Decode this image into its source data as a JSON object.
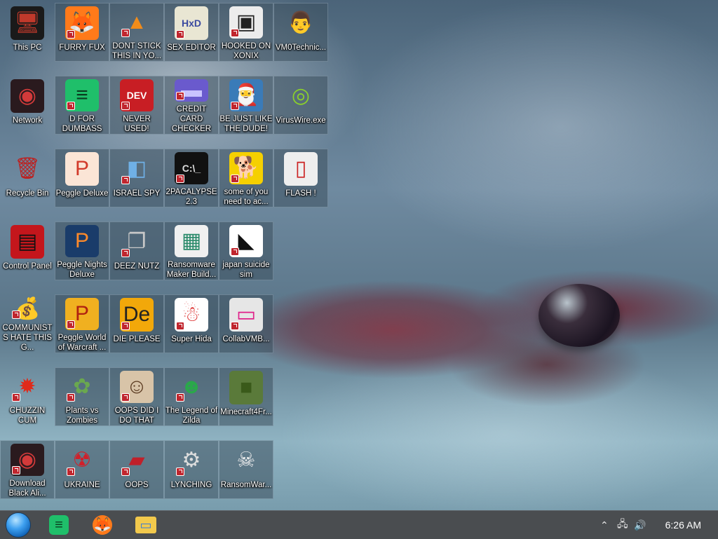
{
  "desktop": {
    "icons": [
      {
        "name": "this-pc",
        "label": "This PC",
        "glyph": "🖥",
        "bg": "#1a1a1a",
        "fg": "#c0392b",
        "shortcut": false
      },
      {
        "name": "furry-fux",
        "label": "FURRY FUX",
        "glyph": "🦊",
        "bg": "#ff7a1a",
        "fg": "#5a2bd6",
        "shortcut": true
      },
      {
        "name": "dont-stick-this",
        "label": "DONT STICK THIS IN YO...",
        "glyph": "▲",
        "bg": "transparent",
        "fg": "#f28c1a",
        "shortcut": true
      },
      {
        "name": "sex-editor",
        "label": "SEX EDITOR",
        "glyph": "HxD",
        "bg": "#e9e6d3",
        "fg": "#3b4aa0",
        "shortcut": true
      },
      {
        "name": "hooked-on-xonix",
        "label": "HOOKED ON XONIX",
        "glyph": "▣",
        "bg": "#ececec",
        "fg": "#222",
        "shortcut": true
      },
      {
        "name": "vm0technic",
        "label": "VM0Technic...",
        "glyph": "👨",
        "bg": "transparent",
        "fg": "#e8a060",
        "shortcut": false
      },
      {
        "name": "network",
        "label": "Network",
        "glyph": "◉",
        "bg": "#2a1a1e",
        "fg": "#d23a3a",
        "shortcut": false
      },
      {
        "name": "d-for-dumbass",
        "label": "D FOR DUMBASS",
        "glyph": "≡",
        "bg": "#1fbf6a",
        "fg": "#0a3d20",
        "shortcut": true
      },
      {
        "name": "never-used",
        "label": "NEVER USED!",
        "glyph": "DEV",
        "bg": "#c81e24",
        "fg": "#ffffff",
        "shortcut": true
      },
      {
        "name": "credit-card-checker",
        "label": "CREDIT CARD CHECKER",
        "glyph": "▬",
        "bg": "#6a5acd",
        "fg": "#c9c3ff",
        "shortcut": true
      },
      {
        "name": "be-just-like-the-dude",
        "label": "BE JUST LIKE THE DUDE!",
        "glyph": "🎅",
        "bg": "#3a7bb8",
        "fg": "#fff",
        "shortcut": true
      },
      {
        "name": "viruswire",
        "label": "VirusWire.exe",
        "glyph": "◎",
        "bg": "transparent",
        "fg": "#8bd12a",
        "shortcut": false
      },
      {
        "name": "recycle-bin",
        "label": "Recycle Bin",
        "glyph": "🗑",
        "bg": "transparent",
        "fg": "#b22",
        "shortcut": false
      },
      {
        "name": "peggle-deluxe",
        "label": "Peggle Deluxe",
        "glyph": "P",
        "bg": "#fbe5d6",
        "fg": "#d23a2a",
        "shortcut": false
      },
      {
        "name": "israel-spy",
        "label": "ISRAEL SPY",
        "glyph": "◧",
        "bg": "transparent",
        "fg": "#6fb0e6",
        "shortcut": true
      },
      {
        "name": "2pacalypse",
        "label": "2PACALYPSE 2.3",
        "glyph": "C:\\_",
        "bg": "#111",
        "fg": "#ddd",
        "shortcut": true
      },
      {
        "name": "some-of-you-need-to",
        "label": "some of you need to ac...",
        "glyph": "🐕",
        "bg": "#f5d000",
        "fg": "#7a3a10",
        "shortcut": true
      },
      {
        "name": "flash",
        "label": "FLASH !",
        "glyph": "▯",
        "bg": "#eee",
        "fg": "#c22",
        "shortcut": false
      },
      {
        "name": "control-panel",
        "label": "Control Panel",
        "glyph": "▤",
        "bg": "#c4161c",
        "fg": "#111",
        "shortcut": false
      },
      {
        "name": "peggle-nights-deluxe",
        "label": "Peggle Nights Deluxe",
        "glyph": "P",
        "bg": "#1a3c6a",
        "fg": "#ff8a2a",
        "shortcut": false
      },
      {
        "name": "deez-nutz",
        "label": "DEEZ NUTZ",
        "glyph": "❐",
        "bg": "transparent",
        "fg": "#c8c8c8",
        "shortcut": true
      },
      {
        "name": "ransomware-maker",
        "label": "Ransomware Maker Build...",
        "glyph": "▦",
        "bg": "#f0f0f0",
        "fg": "#2a8a6a",
        "shortcut": false
      },
      {
        "name": "japan-suicide-sim",
        "label": "japan suicide sim",
        "glyph": "◣",
        "bg": "#ffffff",
        "fg": "#111",
        "shortcut": true
      },
      {
        "name": "communists-hate-this",
        "label": "COMMUNISTS HATE THIS G...",
        "glyph": "💰",
        "bg": "transparent",
        "fg": "#c89a40",
        "shortcut": true
      },
      {
        "name": "peggle-world-of-warcraft",
        "label": "Peggle World of Warcraft ...",
        "glyph": "P",
        "bg": "#f0b020",
        "fg": "#b02010",
        "shortcut": true
      },
      {
        "name": "die-please",
        "label": "DIE PLEASE",
        "glyph": "De",
        "bg": "#f2a80a",
        "fg": "#222",
        "shortcut": true
      },
      {
        "name": "super-hida",
        "label": "Super Hida",
        "glyph": "☃",
        "bg": "#fff",
        "fg": "#d33",
        "shortcut": true
      },
      {
        "name": "collabvmb",
        "label": "CollabVMB...",
        "glyph": "▭",
        "bg": "#e6e6e6",
        "fg": "#e0208a",
        "shortcut": true
      },
      {
        "name": "chuzzin-cum",
        "label": "CHUZZIN CUM",
        "glyph": "✹",
        "bg": "transparent",
        "fg": "#e02a1a",
        "shortcut": true
      },
      {
        "name": "plants-vs-zombies",
        "label": "Plants vs Zombies",
        "glyph": "✿",
        "bg": "transparent",
        "fg": "#6aa84f",
        "shortcut": true
      },
      {
        "name": "oops-did-i-do-that",
        "label": "OOPS DID I DO THAT",
        "glyph": "☺",
        "bg": "#d8c4a8",
        "fg": "#5a3a20",
        "shortcut": true
      },
      {
        "name": "legend-of-zilda",
        "label": "The Legend of Zilda",
        "glyph": "☻",
        "bg": "transparent",
        "fg": "#2aa84a",
        "shortcut": true
      },
      {
        "name": "minecraft4fr",
        "label": "Minecraft4Fr...",
        "glyph": "■",
        "bg": "#5a7a3a",
        "fg": "#3a5a1a",
        "shortcut": false
      },
      {
        "name": "download-black-ali",
        "label": "Download Black Ali...",
        "glyph": "◉",
        "bg": "#2a1a1e",
        "fg": "#d23a3a",
        "shortcut": true
      },
      {
        "name": "ukraine",
        "label": "UKRAINE",
        "glyph": "☢",
        "bg": "transparent",
        "fg": "#d0202a",
        "shortcut": true
      },
      {
        "name": "oops",
        "label": "OOPS",
        "glyph": "▰",
        "bg": "transparent",
        "fg": "#c0202a",
        "shortcut": true
      },
      {
        "name": "lynching",
        "label": "LYNCHING",
        "glyph": "⚙",
        "bg": "transparent",
        "fg": "#ddd",
        "shortcut": true
      },
      {
        "name": "ransomwar",
        "label": "RansomWar...",
        "glyph": "☠",
        "bg": "transparent",
        "fg": "#eee",
        "shortcut": false
      }
    ]
  },
  "taskbar": {
    "pinned": [
      {
        "name": "start-orb-button",
        "glyph": ""
      },
      {
        "name": "taskbar-notes-app",
        "glyph": "≡",
        "bg": "#1fbf6a",
        "fg": "#0a3d20"
      },
      {
        "name": "taskbar-firefox",
        "glyph": "🦊",
        "bg": "#ff7a1a",
        "fg": "#5a2bd6"
      },
      {
        "name": "taskbar-file-explorer",
        "glyph": "▭",
        "bg": "#f2c94c",
        "fg": "#3b7bd6"
      }
    ],
    "tray": {
      "chevron": "⌃",
      "network": "🖧",
      "volume": "🔊"
    },
    "clock": "6:26 AM"
  }
}
